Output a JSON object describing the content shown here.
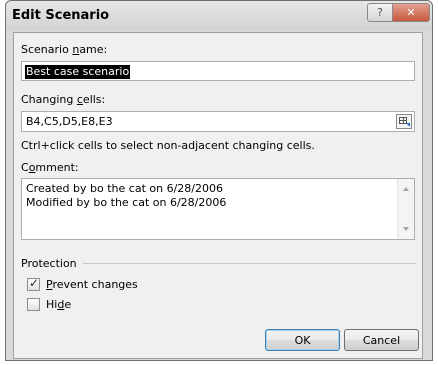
{
  "window": {
    "title": "Edit Scenario",
    "help_glyph": "?",
    "close_glyph": "✕"
  },
  "scenario_name": {
    "label_pre": "Scenario ",
    "label_u": "n",
    "label_post": "ame:",
    "value": "Best case scenario"
  },
  "changing_cells": {
    "label_pre": "Changing ",
    "label_u": "c",
    "label_post": "ells:",
    "value": "B4,C5,D5,E8,E3",
    "hint": "Ctrl+click cells to select non-adjacent changing cells."
  },
  "comment": {
    "label_pre": "C",
    "label_u": "o",
    "label_post": "mment:",
    "line1": "Created by bo the cat on 6/28/2006",
    "line2": "Modified by bo the cat on 6/28/2006"
  },
  "protection": {
    "title": "Protection",
    "prevent": {
      "label_u": "P",
      "label_post": "revent changes",
      "checked": true,
      "check_glyph": "✓"
    },
    "hide": {
      "label_pre": "Hi",
      "label_u": "d",
      "label_post": "e",
      "checked": false
    }
  },
  "buttons": {
    "ok": "OK",
    "cancel": "Cancel"
  },
  "colors": {
    "close_button": "#c7573f",
    "selection": "#000000",
    "ok_focus_border": "#3c7fb1"
  }
}
